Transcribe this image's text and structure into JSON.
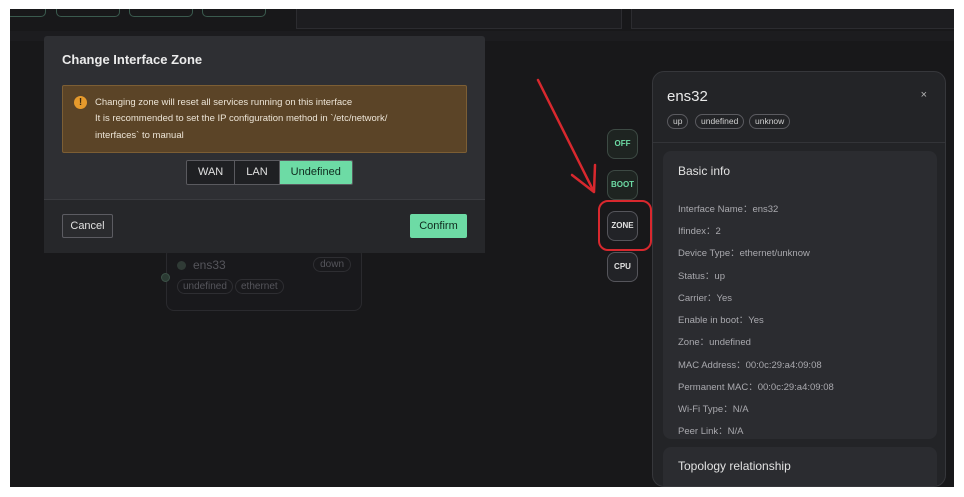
{
  "background": {
    "top_text_left": "",
    "top_text_right": "",
    "node": {
      "name": "ens33",
      "status": "down",
      "tags": [
        "undefined",
        "ethernet"
      ]
    }
  },
  "modal": {
    "title": "Change Interface Zone",
    "warning_lines": [
      "Changing zone will reset all services running on this interface",
      "It is recommended to set the IP configuration method in `/etc/network/",
      "interfaces` to manual"
    ],
    "warning_icon": "!",
    "zones": [
      "WAN",
      "LAN",
      "Undefined"
    ],
    "selected_zone": "Undefined",
    "cancel_label": "Cancel",
    "confirm_label": "Confirm"
  },
  "side_buttons": [
    {
      "label": "OFF",
      "color": "#6ddba5"
    },
    {
      "label": "BOOT",
      "color": "#6ddba5"
    },
    {
      "label": "ZONE",
      "color": "#e0e0e0"
    },
    {
      "label": "CPU",
      "color": "#e0e0e0"
    }
  ],
  "details": {
    "interface_name": "ens32",
    "close_icon": "×",
    "tags": [
      "up",
      "undefined",
      "unknow"
    ],
    "basic_info_title": "Basic info",
    "basic_info": [
      "Interface Name：ens32",
      "Ifindex：2",
      "Device Type：ethernet/unknow",
      "Status：up",
      "Carrier：Yes",
      "Enable in boot：Yes",
      "Zone：undefined",
      "MAC Address：00:0c:29:a4:09:08",
      "Permanent MAC：00:0c:29:a4:09:08",
      "Wi-Fi Type：N/A",
      "Peer Link：N/A"
    ],
    "topology_title": "Topology relationship"
  },
  "colors": {
    "accent": "#6ddba5",
    "annotation": "#d8282e",
    "warning_bg": "#5b4427",
    "warning_icon": "#e69a2c"
  }
}
